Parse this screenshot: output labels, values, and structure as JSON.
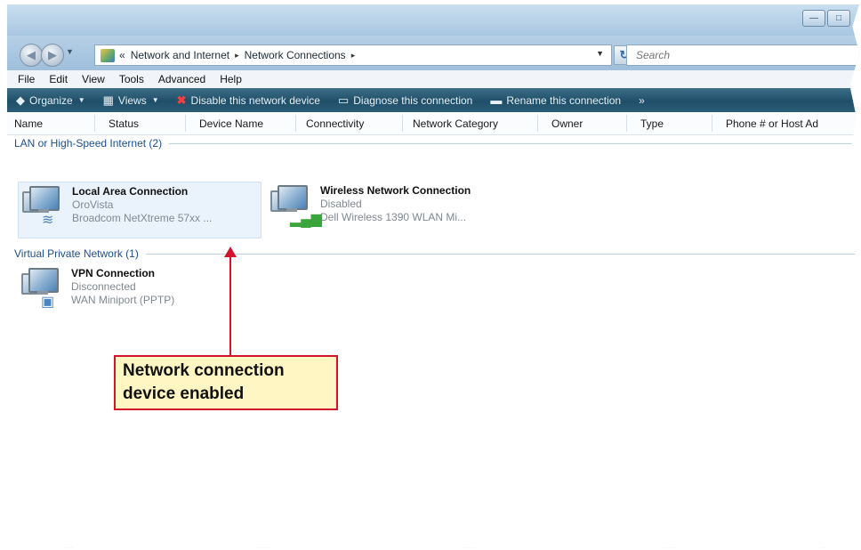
{
  "address": {
    "crumbs": [
      "«",
      "Network and Internet",
      "Network Connections"
    ],
    "sep_glyph": "▸"
  },
  "search": {
    "placeholder": "Search"
  },
  "menu": {
    "items": [
      "File",
      "Edit",
      "View",
      "Tools",
      "Advanced",
      "Help"
    ]
  },
  "toolbar": {
    "organize": "Organize",
    "views": "Views",
    "disable": "Disable this network device",
    "diagnose": "Diagnose this connection",
    "rename": "Rename this connection",
    "more": "»"
  },
  "columns": [
    "Name",
    "Status",
    "Device Name",
    "Connectivity",
    "Network Category",
    "Owner",
    "Type",
    "Phone # or Host Ad"
  ],
  "groups": [
    {
      "title": "LAN or High-Speed Internet (2)",
      "items": [
        {
          "name": "Local Area Connection",
          "line1": "OroVista",
          "line2": "Broadcom NetXtreme 57xx ...",
          "sub_icon": "network-cable-icon"
        },
        {
          "name": "Wireless Network Connection",
          "line1": "Disabled",
          "line2": "Dell Wireless 1390 WLAN Mi...",
          "sub_icon": "signal-bars-icon"
        }
      ]
    },
    {
      "title": "Virtual Private Network (1)",
      "items": [
        {
          "name": "VPN Connection",
          "line1": "Disconnected",
          "line2": "WAN Miniport (PPTP)",
          "sub_icon": "modem-icon"
        }
      ]
    }
  ],
  "callout": {
    "line1": "Network connection",
    "line2": "device enabled"
  },
  "colors": {
    "accent": "#d0152c",
    "callout_bg": "#fff6c4",
    "toolbar": "#1f4e68",
    "group_title": "#1d4e8c"
  }
}
